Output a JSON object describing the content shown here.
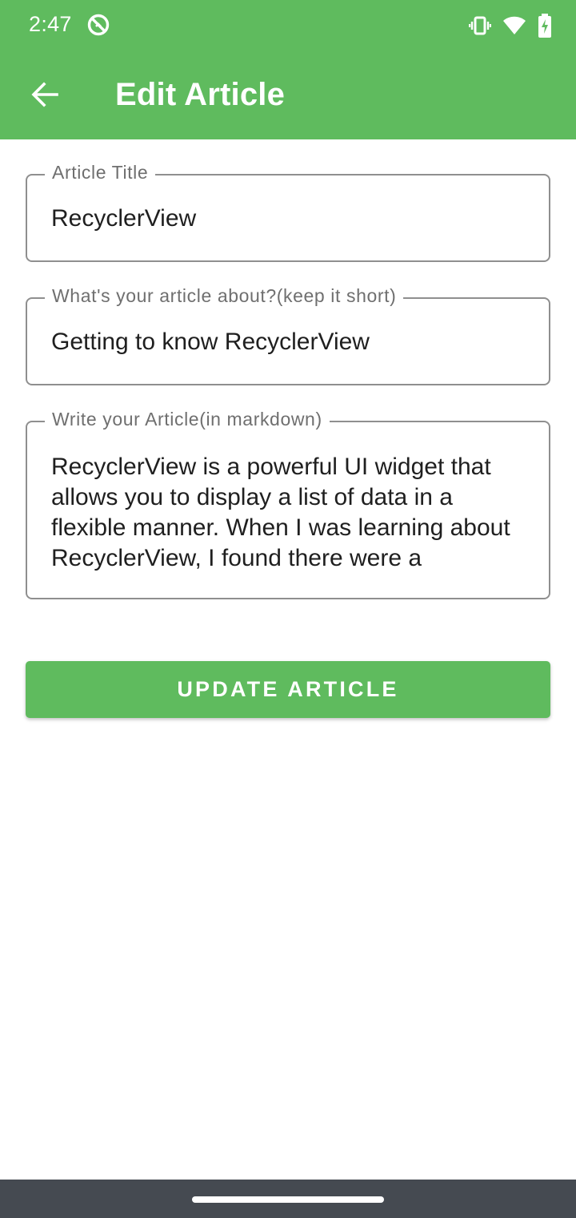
{
  "status_bar": {
    "time": "2:47",
    "icons": [
      "debug-icon",
      "vibrate-icon",
      "wifi-icon",
      "battery-charging-icon"
    ]
  },
  "app_bar": {
    "title": "Edit Article",
    "back_icon": "arrow-back-icon"
  },
  "form": {
    "title_field": {
      "label": "Article Title",
      "value": "RecyclerView"
    },
    "about_field": {
      "label": "What's your article about?(keep it short)",
      "value": "Getting to know RecyclerView"
    },
    "body_field": {
      "label": "Write your Article(in markdown)",
      "value": "RecyclerView is a powerful UI widget that allows you to display a list of data in a flexible manner. When I was learning about RecyclerView, I found there were a"
    },
    "submit_label": "UPDATE ARTICLE"
  },
  "colors": {
    "primary": "#5fbb5e",
    "nav_bar": "#454a51",
    "outline": "#8f8f8f"
  }
}
